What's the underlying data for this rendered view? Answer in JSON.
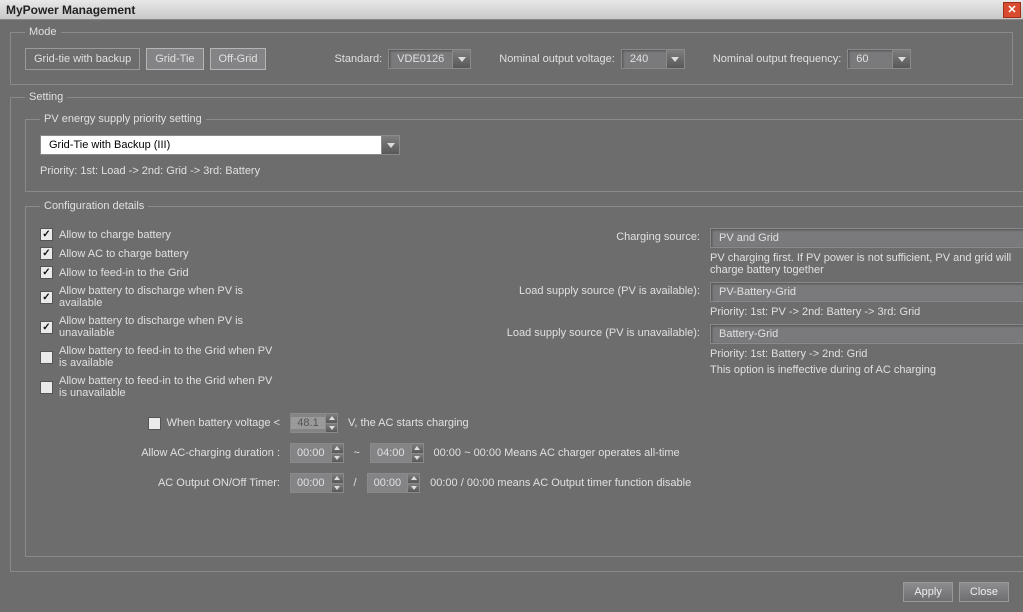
{
  "title": "MyPower Management",
  "mode": {
    "legend": "Mode",
    "buttons": {
      "gridtie_backup": "Grid-tie with backup",
      "gridtie": "Grid-Tie",
      "offgrid": "Off-Grid"
    },
    "standard_label": "Standard:",
    "standard_value": "VDE0126",
    "voltage_label": "Nominal output voltage:",
    "voltage_value": "240",
    "freq_label": "Nominal output frequency:",
    "freq_value": "60"
  },
  "setting": {
    "legend": "Setting",
    "pv_priority": {
      "legend": "PV energy supply priority setting",
      "value": "Grid-Tie with Backup (III)",
      "priority_text": "Priority: 1st: Load -> 2nd: Grid -> 3rd: Battery"
    },
    "config": {
      "legend": "Configuration details",
      "charging_source_label": "Charging source:",
      "charging_source_value": "PV and Grid",
      "charging_source_desc": "PV charging first. If PV power is not sufficient, PV and grid will charge battery together",
      "load_pv_avail_label": "Load supply source (PV is available):",
      "load_pv_avail_value": "PV-Battery-Grid",
      "load_pv_avail_desc": "Priority: 1st: PV -> 2nd: Battery -> 3rd: Grid",
      "load_pv_unavail_label": "Load supply source (PV is unavailable):",
      "load_pv_unavail_value": "Battery-Grid",
      "load_pv_unavail_desc1": "Priority: 1st: Battery -> 2nd: Grid",
      "load_pv_unavail_desc2": "This option is ineffective during of AC charging",
      "checks": {
        "c1": "Allow to charge battery",
        "c2": "Allow AC to charge battery",
        "c3": "Allow to feed-in to the Grid",
        "c4": "Allow battery to discharge when PV is available",
        "c5": "Allow battery to discharge when PV is unavailable",
        "c6": "Allow battery to feed-in to the Grid when PV is available",
        "c7": "Allow battery to feed-in to the Grid when PV is unavailable"
      },
      "batt_voltage_label": "When battery voltage <",
      "batt_voltage_value": "48.1",
      "batt_voltage_suffix": "V,    the AC starts charging",
      "ac_charging_label": "Allow AC-charging duration :",
      "ac_charging_from": "00:00",
      "ac_charging_sep": "~",
      "ac_charging_to": "04:00",
      "ac_charging_desc": "00:00  ~  00:00 Means AC charger operates all-time",
      "ac_output_label": "AC Output ON/Off Timer:",
      "ac_output_from": "00:00",
      "ac_output_sep": "/",
      "ac_output_to": "00:00",
      "ac_output_desc": "00:00 / 00:00 means AC Output timer function disable"
    }
  },
  "footer": {
    "apply": "Apply",
    "close": "Close"
  }
}
